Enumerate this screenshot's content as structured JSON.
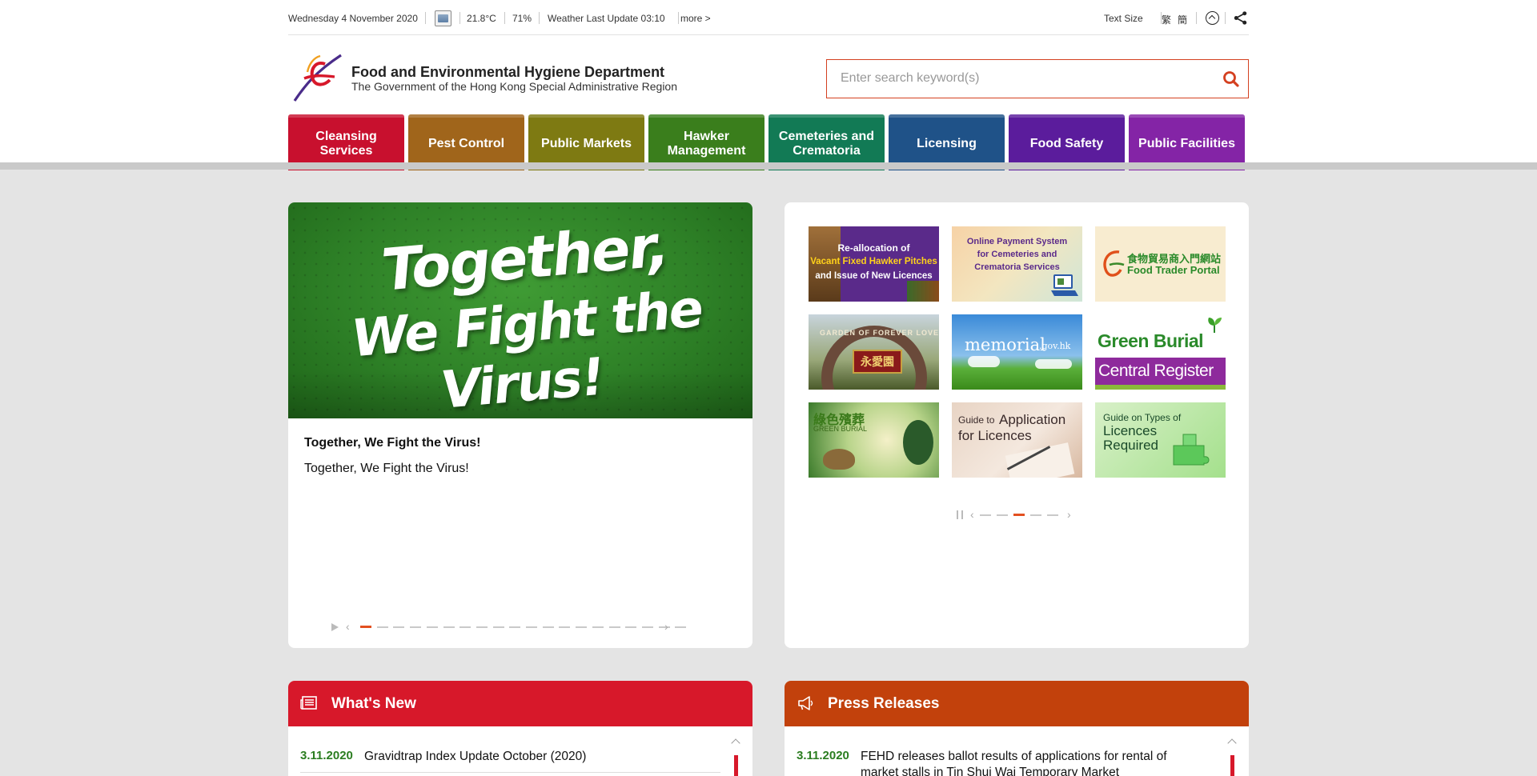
{
  "topbar": {
    "date": "Wednesday 4 November 2020",
    "temperature": "21.8°C",
    "humidity": "71%",
    "weather_update": "Weather Last Update 03:10",
    "more": "more >",
    "text_size": "Text Size",
    "lang_trad": "繁",
    "lang_simp": "簡"
  },
  "header": {
    "dept_name": "Food and Environmental Hygiene Department",
    "dept_sub": "The Government of the Hong Kong Special Administrative Region"
  },
  "search": {
    "placeholder": "Enter search keyword(s)",
    "value": ""
  },
  "nav": {
    "items": [
      {
        "label": "Cleansing Services",
        "color": "#c8102e"
      },
      {
        "label": "Pest Control",
        "color": "#a0651b"
      },
      {
        "label": "Public Markets",
        "color": "#7e7a12"
      },
      {
        "label": "Hawker Management",
        "color": "#3a7e1c"
      },
      {
        "label": "Cemeteries and Crematoria",
        "color": "#127a55"
      },
      {
        "label": "Licensing",
        "color": "#1f5288"
      },
      {
        "label": "Food Safety",
        "color": "#5b1c9c"
      },
      {
        "label": "Public Facilities",
        "color": "#8424a6"
      }
    ]
  },
  "hero": {
    "banner_line1": "Together,",
    "banner_line2": "We Fight the Virus!",
    "title": "Together, We Fight the Virus!",
    "description": "Together, We Fight the Virus!",
    "prev": "‹",
    "next": "›",
    "slide_count": 20,
    "active_slide": 1
  },
  "quick_links": {
    "tiles": [
      {
        "lines": [
          "Re-allocation of",
          "Vacant Fixed Hawker Pitches",
          "and Issue of New Licences"
        ]
      },
      {
        "lines": [
          "Online Payment System",
          "for Cemeteries and",
          "Crematoria Services"
        ]
      },
      {
        "lines": [
          "食物貿易商入門網站",
          "Food Trader Portal"
        ]
      },
      {
        "lines": [
          "GARDEN OF FOREVER LOVE",
          "永愛園"
        ]
      },
      {
        "lines": [
          "memorial",
          ".gov.hk"
        ]
      },
      {
        "lines": [
          "Green Burial",
          "Central Register"
        ]
      },
      {
        "lines": [
          "綠色殯葬",
          "GREEN BURIAL"
        ]
      },
      {
        "lines": [
          "Guide to",
          "Application",
          "for Licences"
        ]
      },
      {
        "lines": [
          "Guide on Types of",
          "Licences",
          "Required"
        ]
      }
    ],
    "prev": "‹",
    "next": "›",
    "slide_count": 5,
    "active_slide": 3
  },
  "whats_new": {
    "title": "What's New",
    "color": "#d7182a",
    "items": [
      {
        "date": "3.11.2020",
        "text": "Gravidtrap Index Update October (2020)"
      }
    ]
  },
  "press_releases": {
    "title": "Press Releases",
    "color": "#c2410c",
    "items": [
      {
        "date": "3.11.2020",
        "text": "FEHD releases ballot results of applications for rental of market stalls in Tin Shui Wai Temporary Market"
      }
    ]
  }
}
